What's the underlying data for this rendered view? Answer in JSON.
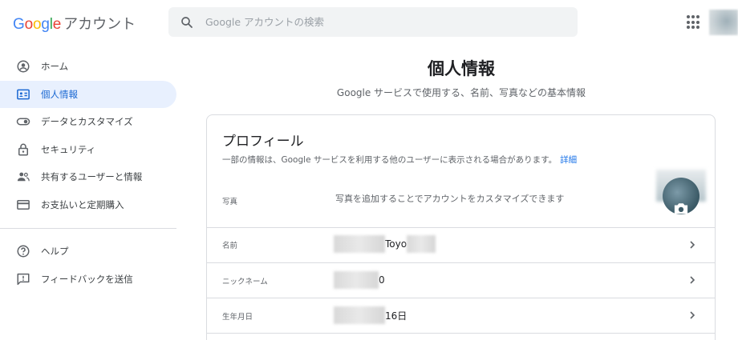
{
  "header": {
    "logo_word": "Google",
    "logo_product": "アカウント",
    "search_placeholder": "Google アカウントの検索",
    "icons": {
      "search": "search-icon",
      "apps": "apps-grid-icon",
      "avatar": "account-avatar"
    }
  },
  "sidebar": {
    "items": [
      {
        "label": "ホーム",
        "icon": "home-person-icon",
        "active": false
      },
      {
        "label": "個人情報",
        "icon": "id-card-icon",
        "active": true
      },
      {
        "label": "データとカスタマイズ",
        "icon": "toggle-icon",
        "active": false
      },
      {
        "label": "セキュリティ",
        "icon": "lock-icon",
        "active": false
      },
      {
        "label": "共有するユーザーと情報",
        "icon": "people-icon",
        "active": false
      },
      {
        "label": "お支払いと定期購入",
        "icon": "credit-card-icon",
        "active": false
      }
    ],
    "footer_items": [
      {
        "label": "ヘルプ",
        "icon": "help-icon"
      },
      {
        "label": "フィードバックを送信",
        "icon": "feedback-icon"
      }
    ]
  },
  "main": {
    "title": "個人情報",
    "subtitle": "Google サービスで使用する、名前、写真などの基本情報",
    "profile_card": {
      "title": "プロフィール",
      "description": "一部の情報は、Google サービスを利用する他のユーザーに表示される場合があります。",
      "details_link": "詳細",
      "rows": [
        {
          "label": "写真",
          "value": "写真を追加することでアカウントをカスタマイズできます"
        },
        {
          "label": "名前",
          "value_visible": "Toyo"
        },
        {
          "label": "ニックネーム",
          "value_visible": "0"
        },
        {
          "label": "生年月日",
          "value_visible": "16日"
        }
      ]
    }
  },
  "colors": {
    "accent": "#1a73e8",
    "active_bg": "#e8f0fe",
    "active_text": "#1967d2"
  }
}
